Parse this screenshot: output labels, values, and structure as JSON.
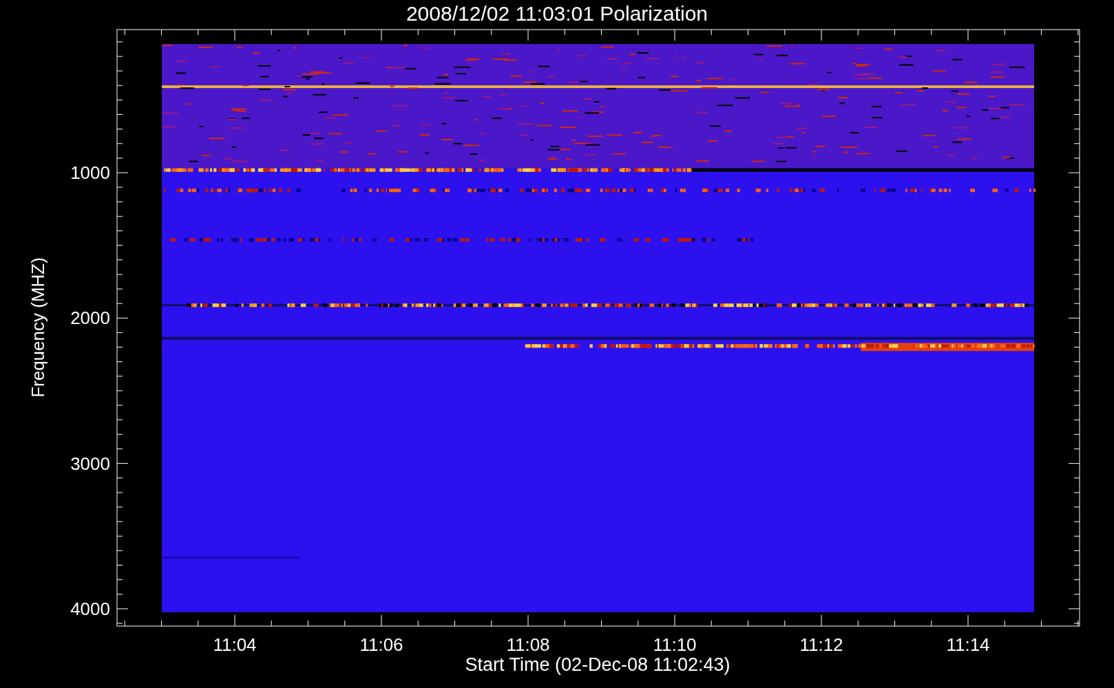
{
  "plot": {
    "title": "2008/12/02 11:03:01 Polarization",
    "xlabel": "Start Time (02-Dec-08 11:02:43)",
    "ylabel": "Frequency (MHZ)",
    "x_ticks": [
      "11:04",
      "11:06",
      "11:08",
      "11:10",
      "11:12",
      "11:14"
    ],
    "y_ticks": [
      "1000",
      "2000",
      "3000",
      "4000"
    ]
  }
}
